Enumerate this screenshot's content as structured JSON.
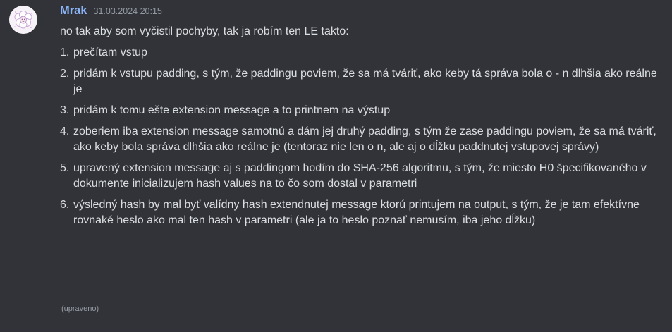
{
  "author": {
    "name": "Mrak",
    "name_color": "#8ab4f8"
  },
  "timestamp": "31.03.2024 20:15",
  "message": {
    "intro": "no tak aby som vyčistil pochyby, tak ja robím ten LE takto:",
    "steps": [
      {
        "num": "1.",
        "text": "prečítam vstup"
      },
      {
        "num": "2.",
        "text": "pridám k vstupu padding, s tým, že paddingu poviem, že sa má tváriť, ako keby tá správa bola o - n dlhšia ako reálne je"
      },
      {
        "num": "3.",
        "text": "pridám k tomu ešte extension message a to printnem na výstup"
      },
      {
        "num": "4.",
        "text": "zoberiem iba extension message samotnú a dám jej druhý padding, s tým že zase paddingu poviem, že sa má tváriť, ako keby bola správa dlhšia ako reálne je (tentoraz nie len o n, ale aj o dĺžku paddnutej vstupovej správy)"
      },
      {
        "num": "5.",
        "text": "upravený extension message aj s paddingom hodím do SHA-256 algoritmu, s tým, že miesto H0 špecifikovaného v dokumente inicializujem hash values na to čo som dostal v parametri"
      },
      {
        "num": "6.",
        "text": "výsledný hash by mal byť valídny hash extendnutej message ktorú printujem na output, s tým, že je tam efektívne rovnaké heslo ako mal ten hash v parametri (ale ja to heslo poznať nemusím, iba jeho dĺžku)"
      }
    ],
    "edited_label": "(upraveno)"
  },
  "colors": {
    "background": "#313338",
    "text": "#dbdee1",
    "muted": "#949ba4"
  },
  "icons": {
    "avatar": "sheep-avatar-icon"
  }
}
